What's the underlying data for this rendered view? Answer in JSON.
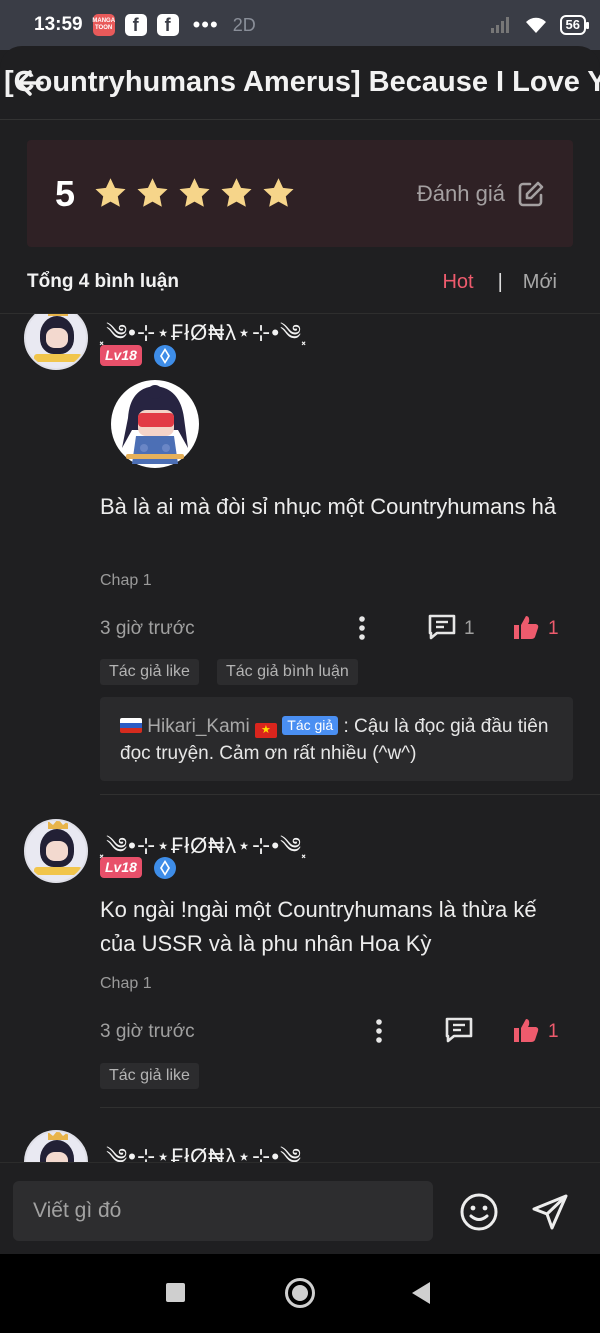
{
  "status_bar": {
    "time": "13:59",
    "manga_app_label": "MANGA TOON",
    "fb_label": "f",
    "more": "•••",
    "background_text": "2D",
    "battery": "56"
  },
  "header": {
    "title": "[Countryhumans Amerus] Because I Love Y..."
  },
  "rating": {
    "value": "5",
    "stars": 5,
    "rate_label": "Đánh giá"
  },
  "comments_header": {
    "count_label": "Tổng 4 bình luận",
    "sort_hot": "Hot",
    "sort_divider": "|",
    "sort_new": "Mới"
  },
  "comments": [
    {
      "username": "⸼༄•⊹⋆₣łØ₦λ⋆⊹•༄⸼",
      "level": "Lv18",
      "text": "Bà là ai mà đòi sỉ nhục một Countryhumans hả",
      "chapter": "Chap 1",
      "time": "3 giờ trước",
      "replies": "1",
      "likes": "1",
      "tags": [
        "Tác giả like",
        "Tác giả bình luận"
      ],
      "reply": {
        "name": "Hikari_Kami",
        "author_badge": "Tác giả",
        "text": ": Cậu là đọc giả đầu tiên đọc truyện. Cảm ơn rất nhiều (^w^)"
      }
    },
    {
      "username": "⸼༄•⊹⋆₣łØ₦λ⋆⊹•༄⸼",
      "level": "Lv18",
      "text": "Ko ngài !ngài một Countryhumans là thừa kế của USSR và là phu nhân Hoa Kỳ",
      "chapter": "Chap 1",
      "time": "3 giờ trước",
      "likes": "1",
      "tags": [
        "Tác giả like"
      ]
    },
    {
      "username": "⸼༄•⊹⋆₣łØ₦λ⋆⊹•༄⸼"
    }
  ],
  "composer": {
    "placeholder": "Viết gì đó"
  },
  "colors": {
    "accent": "#ee5b6d",
    "star": "#f6d58a",
    "rating_card": "#2f2125",
    "author_badge": "#4a8ff2"
  }
}
